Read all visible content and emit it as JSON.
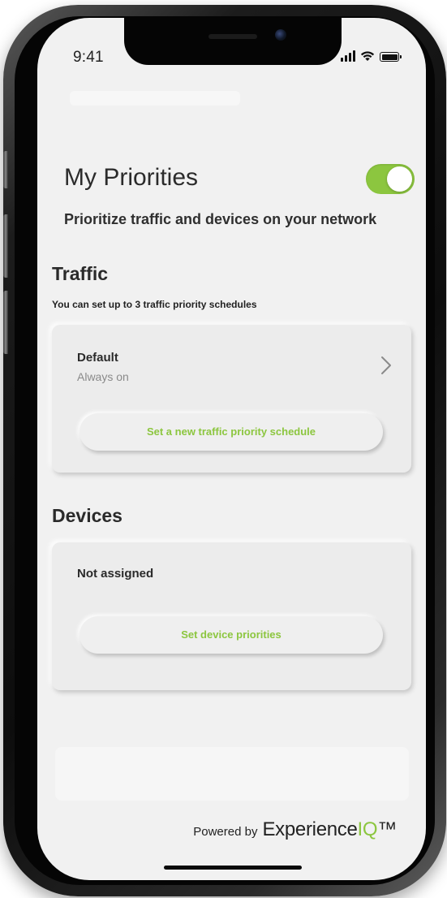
{
  "status_bar": {
    "time": "9:41"
  },
  "header": {
    "title": "My Priorities",
    "toggle_on": true,
    "subtitle": "Prioritize traffic and devices on your network"
  },
  "traffic": {
    "heading": "Traffic",
    "note": "You can set up to 3 traffic priority schedules",
    "schedule": {
      "title": "Default",
      "status": "Always on"
    },
    "button_label": "Set a new traffic priority schedule"
  },
  "devices": {
    "heading": "Devices",
    "status": "Not assigned",
    "button_label": "Set device priorities"
  },
  "footer": {
    "powered_by": "Powered by",
    "brand_prefix": "Experience",
    "brand_suffix": "IQ",
    "trademark": "™"
  },
  "colors": {
    "accent": "#8cc63f",
    "screen_background": "#f1f1f1",
    "card_background": "#ececec"
  },
  "icons": {
    "signal": "cellular-signal-icon",
    "wifi": "wifi-icon",
    "battery": "battery-icon",
    "chevron": "chevron-right-icon"
  }
}
